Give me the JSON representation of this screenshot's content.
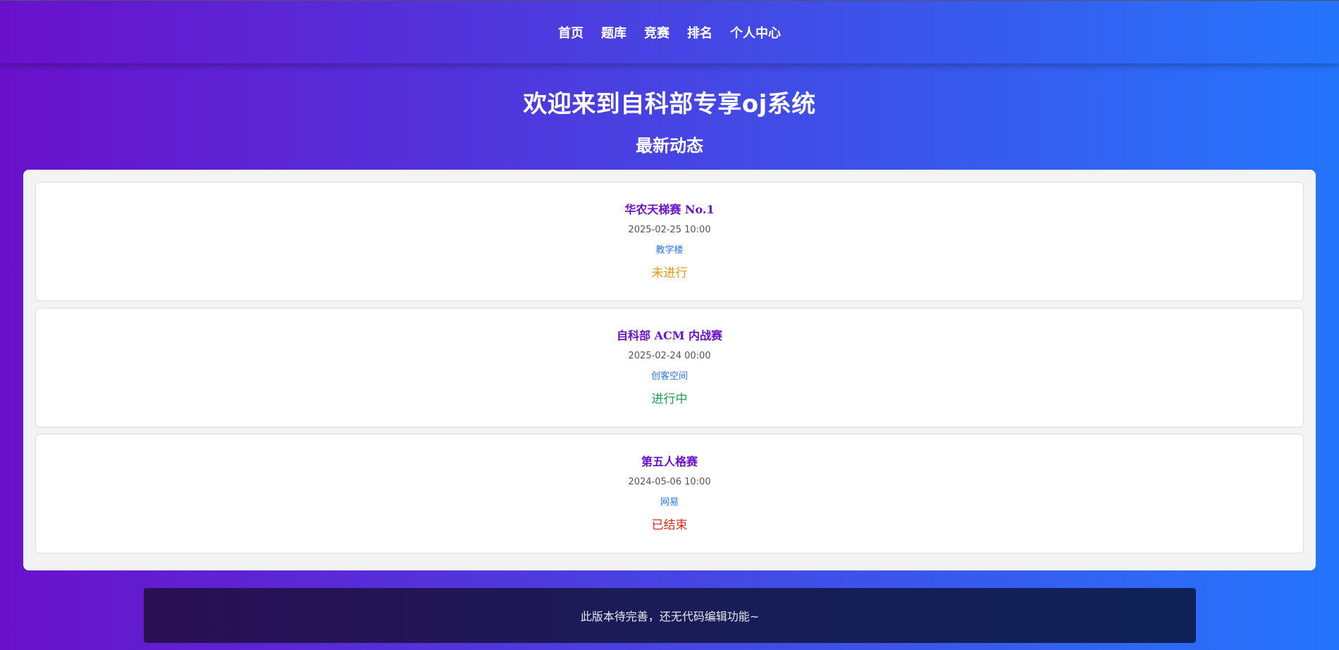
{
  "nav": {
    "items": [
      "首页",
      "题库",
      "竞赛",
      "排名",
      "个人中心"
    ]
  },
  "header": {
    "welcome": "欢迎来到自科部专享oj系统",
    "subtitle": "最新动态"
  },
  "contests": [
    {
      "title": "华农天梯赛 No.1",
      "date": "2025-02-25 10:00",
      "place": "教学楼",
      "status": "未进行",
      "status_color": "#f0960a"
    },
    {
      "title": "自科部 ACM 内战赛",
      "date": "2025-02-24 00:00",
      "place": "创客空间",
      "status": "进行中",
      "status_color": "#1e9e4a"
    },
    {
      "title": "第五人格赛",
      "date": "2024-05-06 10:00",
      "place": "网易",
      "status": "已结束",
      "status_color": "#e0291a"
    }
  ],
  "footer": {
    "text": "此版本待完善，还无代码编辑功能~"
  },
  "colors": {
    "gradient_start": "#6a11cb",
    "gradient_end": "#2575fc",
    "title_color": "#6a11cb",
    "place_color": "#2575fc"
  }
}
